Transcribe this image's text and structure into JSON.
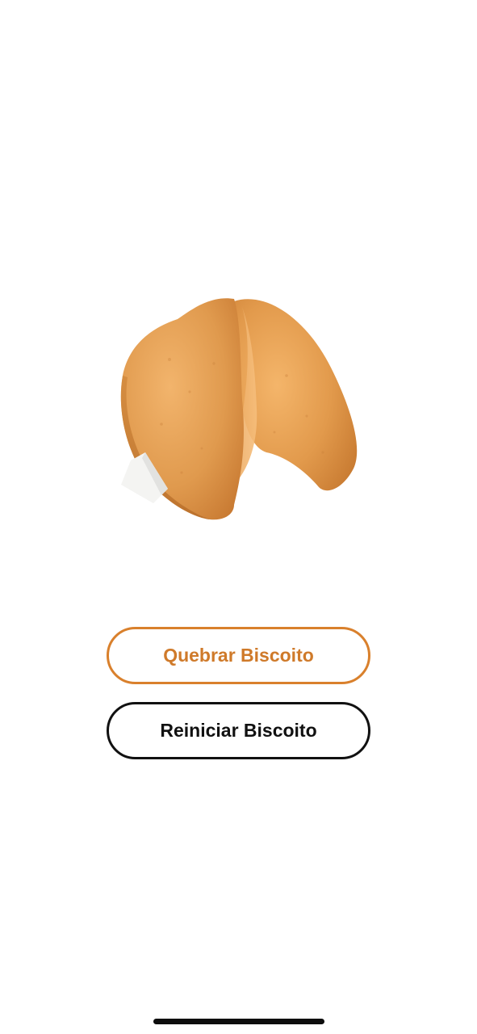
{
  "cookie": {
    "icon": "fortune-cookie-image"
  },
  "buttons": {
    "break_label": "Quebrar Biscoito",
    "reset_label": "Reiniciar Biscoito"
  },
  "colors": {
    "accent": "#cf7a2a",
    "reset_border": "#111111",
    "background": "#ffffff"
  }
}
